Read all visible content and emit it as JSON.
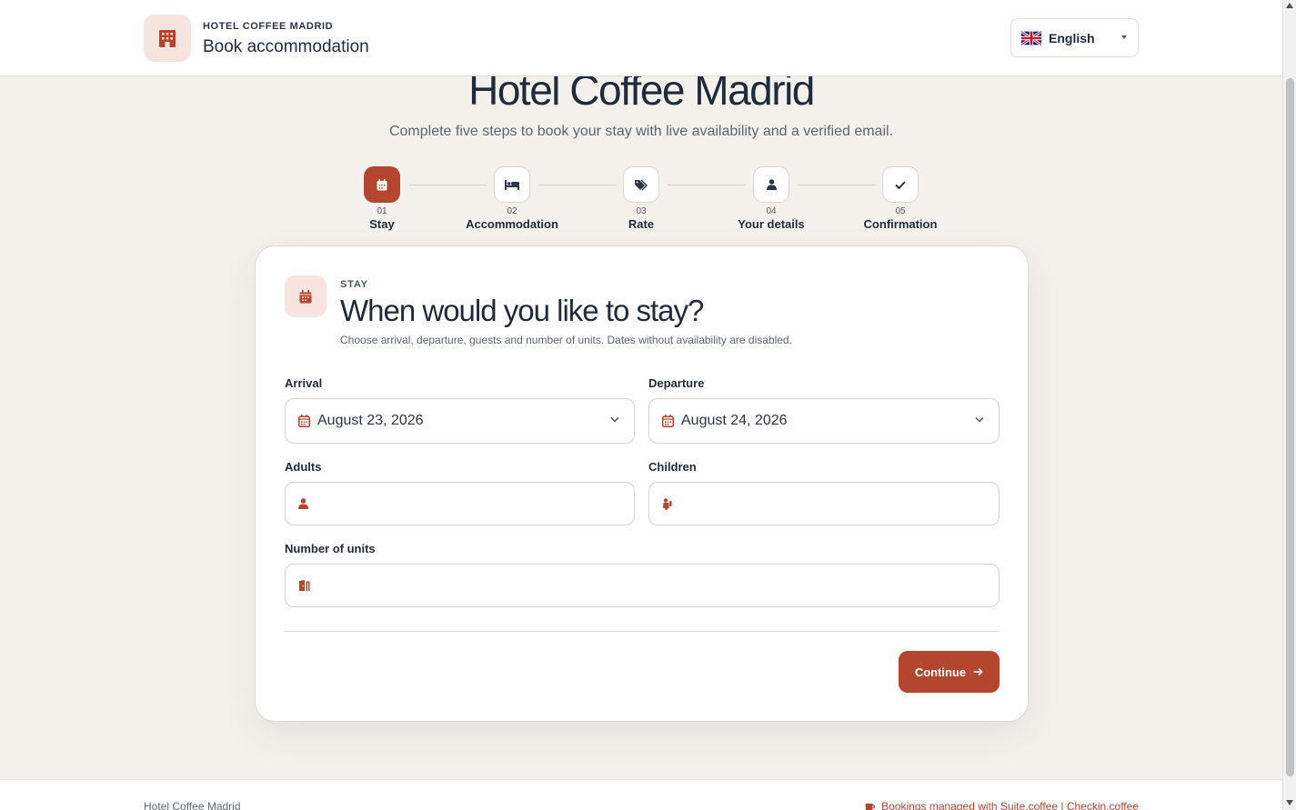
{
  "header": {
    "eyebrow": "HOTEL COFFEE MADRID",
    "title": "Book accommodation",
    "logo_icon": "hotel-building-icon",
    "language": {
      "selected": "English",
      "flag_icon": "uk-flag-icon"
    }
  },
  "hero": {
    "title": "Hotel Coffee Madrid",
    "subtitle": "Complete five steps to book your stay with live availability and a verified email."
  },
  "steps": [
    {
      "num": "01",
      "label": "Stay",
      "icon": "calendar-icon",
      "active": true
    },
    {
      "num": "02",
      "label": "Accommodation",
      "icon": "bed-icon",
      "active": false
    },
    {
      "num": "03",
      "label": "Rate",
      "icon": "tag-icon",
      "active": false
    },
    {
      "num": "04",
      "label": "Your details",
      "icon": "user-icon",
      "active": false
    },
    {
      "num": "05",
      "label": "Confirmation",
      "icon": "check-icon",
      "active": false
    }
  ],
  "card": {
    "eyebrow": "STAY",
    "title": "When would you like to stay?",
    "description": "Choose arrival, departure, guests and number of units. Dates without availability are disabled.",
    "arrival": {
      "label": "Arrival",
      "value": "August 23, 2026"
    },
    "departure": {
      "label": "Departure",
      "value": "August 24, 2026"
    },
    "adults": {
      "label": "Adults",
      "value": ""
    },
    "children": {
      "label": "Children",
      "value": ""
    },
    "units": {
      "label": "Number of units",
      "value": ""
    },
    "continue_label": "Continue"
  },
  "footer": {
    "left": "Hotel Coffee Madrid",
    "right": "Bookings managed with Suite.coffee | Checkin.coffee"
  },
  "colors": {
    "accent": "#b4452e",
    "accent_soft": "#f7e4df",
    "background": "#f4f1ec",
    "text": "#1f2a3a"
  }
}
